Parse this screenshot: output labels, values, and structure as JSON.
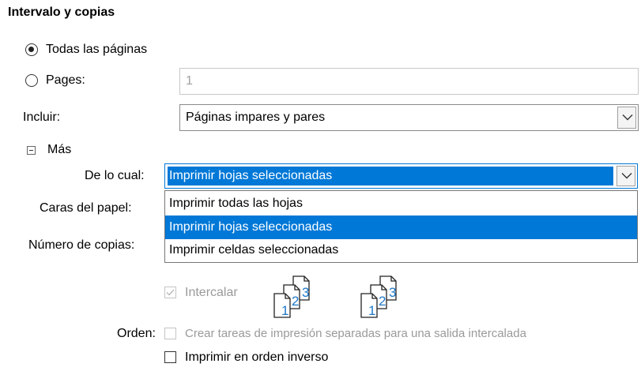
{
  "section_title": "Intervalo y copias",
  "range": {
    "all_pages_label": "Todas las páginas",
    "all_pages_selected": true,
    "pages_label": "Pages:",
    "pages_value": "1"
  },
  "include": {
    "label": "Incluir:",
    "value": "Páginas impares y pares"
  },
  "more": {
    "label": "Más",
    "expanded": true,
    "of_which_label": "De lo cual:",
    "of_which_value": "Imprimir hojas seleccionadas",
    "options": [
      "Imprimir todas las hojas",
      "Imprimir hojas seleccionadas",
      "Imprimir celdas seleccionadas"
    ],
    "selected_option_index": 1,
    "paper_sides_label": "Caras del papel:",
    "copies_label": "Número de copias:"
  },
  "collate": {
    "label": "Intercalar",
    "checked": true,
    "disabled": true,
    "page_numbers": [
      "1",
      "2",
      "3"
    ]
  },
  "order": {
    "label": "Orden:",
    "separate_jobs_label": "Crear tareas de impresión separadas para una salida intercalada",
    "reverse_label": "Imprimir en orden inverso",
    "reverse_checked": false
  },
  "colors": {
    "accent": "#0078d7",
    "disabled_text": "#9a9a9a",
    "icon_number": "#1e78c8"
  }
}
